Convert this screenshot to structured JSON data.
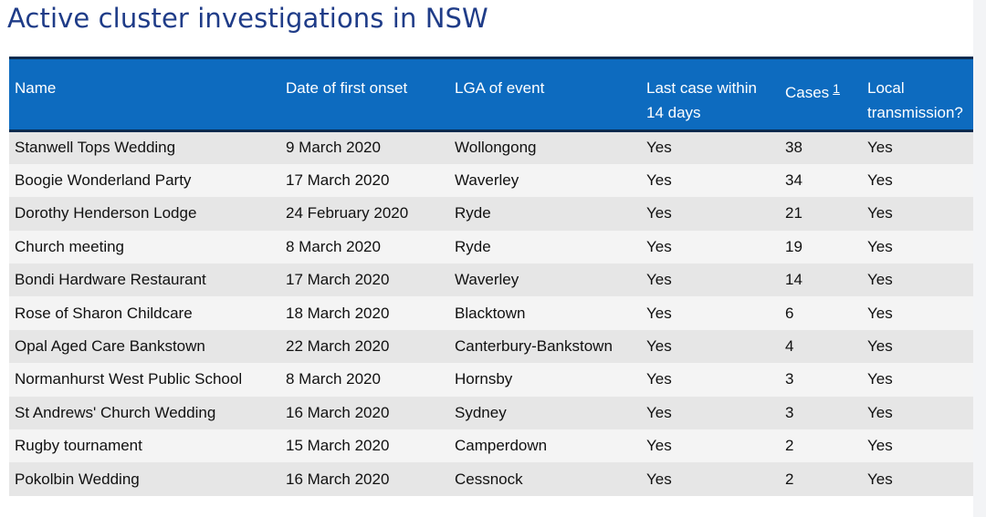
{
  "title": "Active cluster investigations in NSW",
  "table": {
    "headers": {
      "name": "Name",
      "date": "Date of first onset",
      "lga": "LGA of event",
      "last_case_line1": "Last case within",
      "last_case_line2": "14 days",
      "cases": "Cases",
      "cases_footnote": "1",
      "local_line1": "Local",
      "local_line2": "transmission?"
    },
    "rows": [
      {
        "name": "Stanwell Tops Wedding",
        "date": "9 March 2020",
        "lga": "Wollongong",
        "last": "Yes",
        "cases": "38",
        "local": "Yes"
      },
      {
        "name": "Boogie Wonderland Party",
        "date": "17 March 2020",
        "lga": "Waverley",
        "last": "Yes",
        "cases": "34",
        "local": "Yes"
      },
      {
        "name": "Dorothy Henderson Lodge",
        "date": "24 February 2020",
        "lga": "Ryde",
        "last": "Yes",
        "cases": "21",
        "local": "Yes"
      },
      {
        "name": "Church meeting",
        "date": "8 March 2020",
        "lga": "Ryde",
        "last": "Yes",
        "cases": "19",
        "local": "Yes"
      },
      {
        "name": "Bondi Hardware Restaurant",
        "date": "17 March 2020",
        "lga": "Waverley",
        "last": "Yes",
        "cases": "14",
        "local": "Yes"
      },
      {
        "name": "Rose of Sharon Childcare",
        "date": "18 March 2020",
        "lga": "Blacktown",
        "last": "Yes",
        "cases": "6",
        "local": "Yes"
      },
      {
        "name": "Opal Aged Care Bankstown",
        "date": "22 March 2020",
        "lga": "Canterbury-Bankstown",
        "last": "Yes",
        "cases": "4",
        "local": "Yes"
      },
      {
        "name": "Normanhurst West Public School",
        "date": "8 March 2020",
        "lga": "Hornsby",
        "last": "Yes",
        "cases": "3",
        "local": "Yes"
      },
      {
        "name": "St Andrews' Church Wedding",
        "date": "16 March 2020",
        "lga": "Sydney",
        "last": "Yes",
        "cases": "3",
        "local": "Yes"
      },
      {
        "name": "Rugby tournament",
        "date": "15 March 2020",
        "lga": "Camperdown",
        "last": "Yes",
        "cases": "2",
        "local": "Yes"
      },
      {
        "name": "Pokolbin Wedding",
        "date": "16 March 2020",
        "lga": "Cessnock",
        "last": "Yes",
        "cases": "2",
        "local": "Yes"
      }
    ]
  },
  "colors": {
    "title": "#1f3c88",
    "header_bg": "#0d6bbf",
    "header_border": "#0a2b4e",
    "row_odd": "#e6e6e6",
    "row_even": "#f4f4f4"
  }
}
